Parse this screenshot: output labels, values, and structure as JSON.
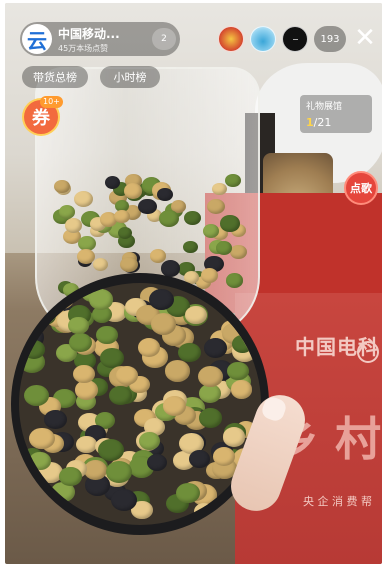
{
  "host": {
    "avatar_glyph": "云",
    "name": "中国移动...",
    "subtitle": "45万本场点赞",
    "follow_count": "2"
  },
  "viewers": {
    "count": "193"
  },
  "close_glyph": "✕",
  "tabs": [
    {
      "label": "带货总榜"
    },
    {
      "label": "小时榜"
    }
  ],
  "coupon": {
    "glyph": "券",
    "badge": "10+"
  },
  "gift_hall": {
    "title": "礼物展馆",
    "current": "1",
    "total": "/21"
  },
  "song_button": {
    "label": "点歌"
  },
  "scene_text": {
    "banner_line1": "中国电科",
    "banner_big": "乡 村",
    "banner_small": "央 企 消 费 帮"
  },
  "colors": {
    "overlay": "rgba(0,0,0,0.32)",
    "song_red": "#e5463c",
    "coupon_orange": "#f26a3e",
    "progress_yellow": "#ffd54a"
  }
}
